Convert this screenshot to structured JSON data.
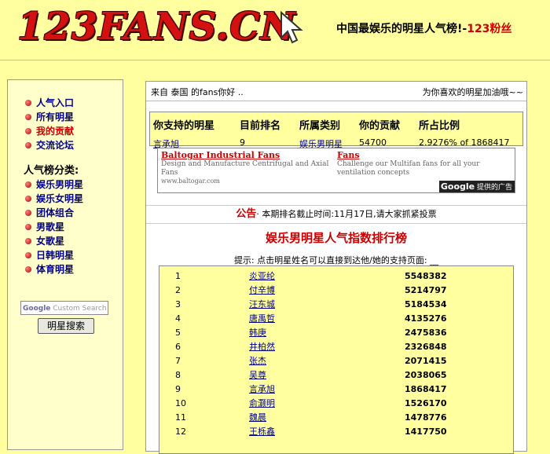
{
  "header": {
    "logo": "123FANS.CN",
    "slogan_main": "中国最娱乐的明星人气榜!-",
    "slogan_accent": "123粉丝"
  },
  "sidebar": {
    "menu_items": [
      {
        "label": "人气入口"
      },
      {
        "label": "所有明星"
      },
      {
        "label": "我的贡献"
      },
      {
        "label": "交流论坛"
      }
    ],
    "category_heading": "人气榜分类:",
    "categories": [
      {
        "label": "娱乐男明星"
      },
      {
        "label": "娱乐女明星"
      },
      {
        "label": "团体组合"
      },
      {
        "label": "男歌星"
      },
      {
        "label": "女歌星"
      },
      {
        "label": "日韩明星"
      },
      {
        "label": "体育明星"
      }
    ],
    "search_brand": "Google",
    "search_placeholder": "Custom Search",
    "search_button": "明星搜索"
  },
  "welcome": {
    "left": "来自 泰国 的fans你好 ..",
    "right": "为你喜欢的明星加油哦~~"
  },
  "stats": {
    "headers": [
      "你支持的明星",
      "目前排名",
      "所属类别",
      "你的贡献",
      "所占比例"
    ],
    "values": [
      "言承旭",
      "9",
      "娱乐男明星",
      "54700",
      "2.9276% of 1868417"
    ]
  },
  "ad": {
    "left_title": "Baltogar Industrial Fans",
    "left_desc": "Design and Manufacture Centrifugal and Axial Fans",
    "left_url": "www.baltogar.com",
    "right_title": "Fans",
    "right_desc": "Challenge our Multifan fans for all your ventilation concepts",
    "badge_brand": "Google",
    "badge_text": "提供的广告"
  },
  "notice": {
    "keyword": "公告",
    "text": "· 本期排名截止时间:11月17日,请大家抓紧投票"
  },
  "ranking": {
    "title": "娱乐男明星人气指数排行榜",
    "hint": "提示: 点击明星姓名可以直接到达他/她的支持页面: __",
    "rows": [
      {
        "rank": "1",
        "name": "炎亚纶",
        "score": "5548382"
      },
      {
        "rank": "2",
        "name": "付辛博",
        "score": "5214797"
      },
      {
        "rank": "3",
        "name": "汪东城",
        "score": "5184534"
      },
      {
        "rank": "4",
        "name": "唐禹哲",
        "score": "4135276"
      },
      {
        "rank": "5",
        "name": "韩庚",
        "score": "2475836"
      },
      {
        "rank": "6",
        "name": "井柏然",
        "score": "2326848"
      },
      {
        "rank": "7",
        "name": "张杰",
        "score": "2071415"
      },
      {
        "rank": "8",
        "name": "吴尊",
        "score": "2038065"
      },
      {
        "rank": "9",
        "name": "言承旭",
        "score": "1868417"
      },
      {
        "rank": "10",
        "name": "俞灏明",
        "score": "1526170"
      },
      {
        "rank": "11",
        "name": "魏晨",
        "score": "1478776"
      },
      {
        "rank": "12",
        "name": "王栎鑫",
        "score": "1417750"
      }
    ]
  }
}
